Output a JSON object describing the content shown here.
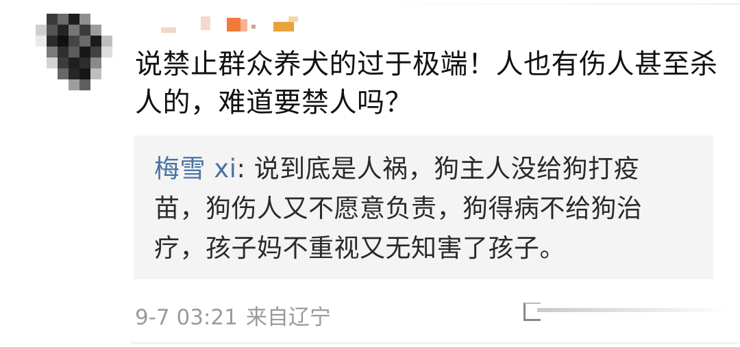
{
  "post": {
    "comment_text": "说禁止群众养犬的过于极端！人也有伤人甚至杀人的，难道要禁人吗？",
    "reply": {
      "author": "梅雪 xi",
      "separator": ": ",
      "text": "说到底是人祸，狗主人没给狗打疫苗，狗伤人又不愿意负责，狗得病不给狗治疗，孩子妈不重视又无知害了孩子。"
    },
    "timestamp": "9-7 03:21",
    "location": "来自辽宁"
  },
  "colors": {
    "reply_author": "#4a72a4",
    "reply_background": "#f4f4f4",
    "meta_text": "#9a9a9a"
  },
  "icons": {
    "comment_action": "pen-icon",
    "avatar": "pixelated-avatar"
  }
}
